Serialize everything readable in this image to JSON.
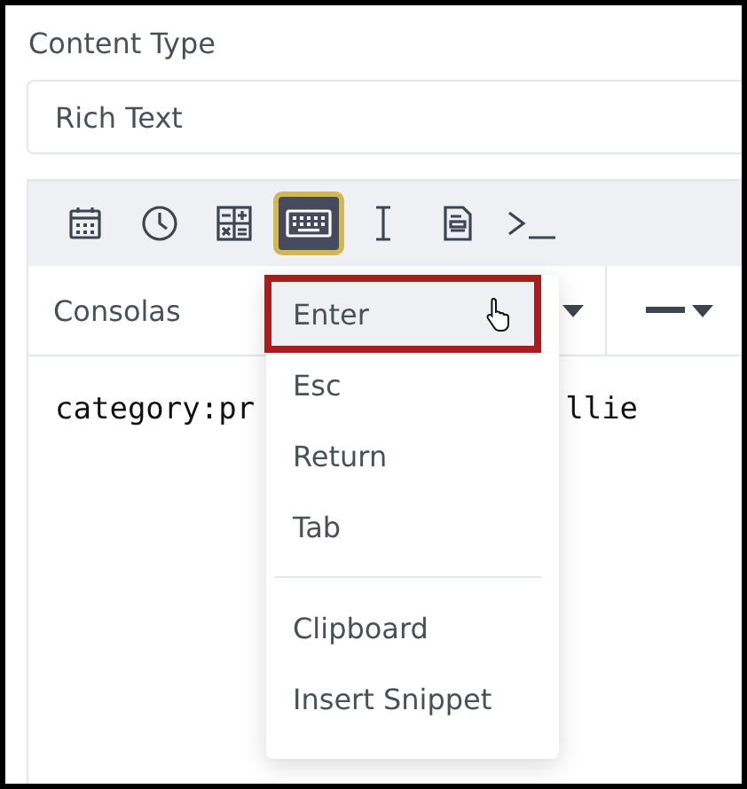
{
  "field": {
    "label": "Content Type",
    "value": "Rich Text"
  },
  "toolbar": [
    {
      "kind": "calendar",
      "selected": false
    },
    {
      "kind": "clock",
      "selected": false
    },
    {
      "kind": "calculator",
      "selected": false
    },
    {
      "kind": "keyboard",
      "selected": true
    },
    {
      "kind": "cursor",
      "selected": false
    },
    {
      "kind": "document",
      "selected": false
    },
    {
      "kind": "terminal",
      "selected": false
    }
  ],
  "font_select": {
    "value": "Consolas"
  },
  "editor": {
    "line_parts": [
      "category:pr",
      "llie"
    ]
  },
  "menu": {
    "items": [
      {
        "kind": "item",
        "label": "Enter",
        "selected": true
      },
      {
        "kind": "item",
        "label": "Esc",
        "selected": false
      },
      {
        "kind": "item",
        "label": "Return",
        "selected": false
      },
      {
        "kind": "item",
        "label": "Tab",
        "selected": false
      },
      {
        "kind": "divider"
      },
      {
        "kind": "item",
        "label": "Clipboard",
        "selected": false
      },
      {
        "kind": "item",
        "label": "Insert Snippet",
        "selected": false
      }
    ]
  }
}
